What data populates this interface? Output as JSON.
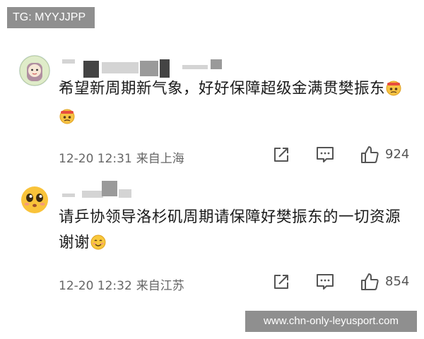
{
  "watermark_top": "TG: MYYJJPP",
  "watermark_bottom": "www.chn-only-leyusport.com",
  "comments": [
    {
      "text": "希望新周期新气象，好好保障超级金满贯樊振东",
      "emoji": [
        "angry-face-emoji",
        "angry-face-emoji"
      ],
      "time": "12-20 12:31",
      "location": "来自上海",
      "likes": "924"
    },
    {
      "text": "请乒协领导洛杉矶周期请保障好樊振东的一切资源谢谢",
      "emoji": [
        "smiling-face-emoji"
      ],
      "time": "12-20 12:32",
      "location": "来自江苏",
      "likes": "854"
    }
  ],
  "icons": {
    "share": "share-icon",
    "comment": "comment-icon",
    "like": "thumbs-up-icon"
  },
  "colors": {
    "watermark_bg": "#8f8f8f",
    "meta_text": "#666666",
    "body_text": "#1a1a1a"
  }
}
